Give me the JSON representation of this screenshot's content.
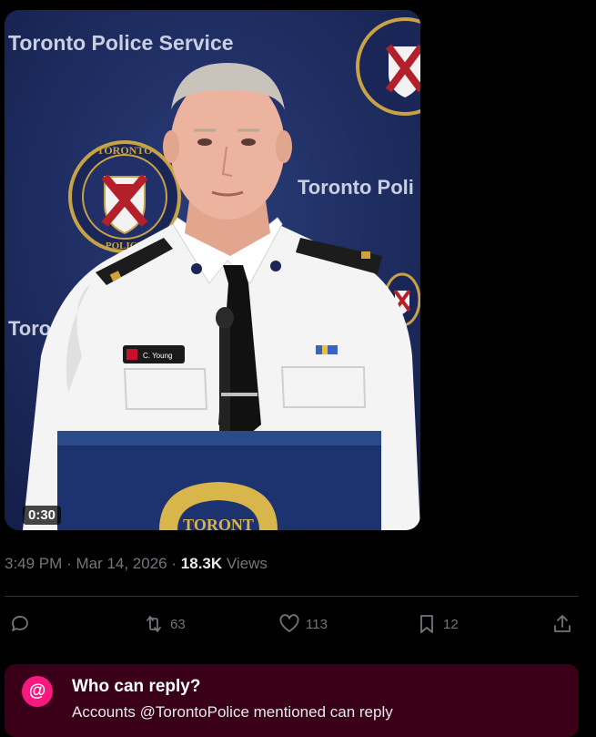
{
  "video": {
    "backdrop_text": "Toronto Police Service",
    "backdrop_text_2": "Toronto Poli",
    "backdrop_text_3": "Toront",
    "crest_text_top": "TORONTO",
    "crest_text_bottom": "POLICE",
    "name_tag": "C. Young",
    "duration": "0:30"
  },
  "meta": {
    "time": "3:49 PM",
    "separator": "·",
    "date": "Mar 14, 2026",
    "views_count": "18.3K",
    "views_label": "Views"
  },
  "actions": {
    "reply_icon": "reply-icon",
    "repost_count": "63",
    "like_count": "113",
    "bookmark_count": "12",
    "share_icon": "share-icon"
  },
  "reply_settings": {
    "badge": "@",
    "title": "Who can reply?",
    "subtitle": "Accounts @TorontoPolice mentioned can reply"
  },
  "colors": {
    "background": "#000000",
    "muted": "#71767b",
    "accent_pink": "#f91880",
    "reply_box_bg": "#3a0018"
  }
}
